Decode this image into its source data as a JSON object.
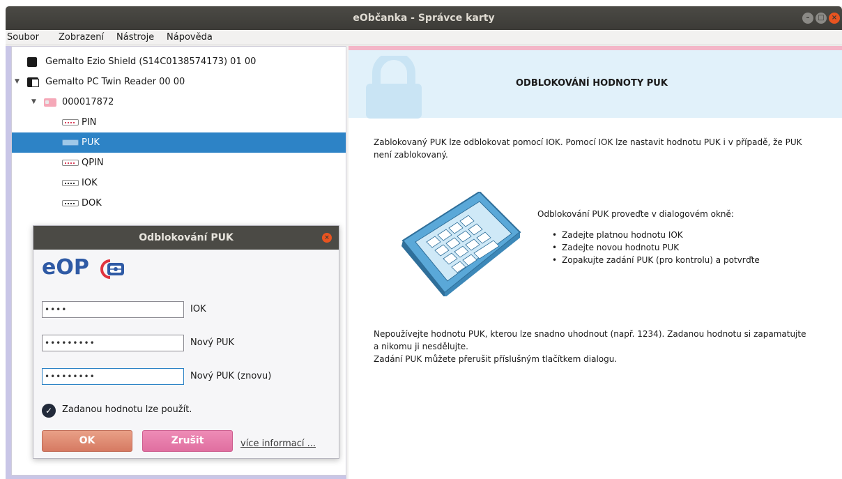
{
  "window": {
    "title": "eObčanka - Správce karty"
  },
  "menu": {
    "items": [
      "Soubor",
      "Zobrazení",
      "Nástroje",
      "Nápověda"
    ]
  },
  "tree": {
    "items": [
      {
        "label": "Gemalto Ezio Shield (S14C0138574173) 01 00",
        "icon": "card-reader-icon"
      },
      {
        "label": "Gemalto PC Twin Reader 00 00",
        "icon": "card-reader-icon"
      },
      {
        "label": "000017872",
        "icon": "id-card-icon"
      },
      {
        "label": "PIN",
        "icon": "key-icon"
      },
      {
        "label": "PUK",
        "icon": "key-icon",
        "selected": true
      },
      {
        "label": "QPIN",
        "icon": "key-icon"
      },
      {
        "label": "IOK",
        "icon": "key-icon"
      },
      {
        "label": "DOK",
        "icon": "key-icon"
      }
    ]
  },
  "dialog": {
    "title": "Odblokování PUK",
    "logo_text": "eOP",
    "fields": [
      {
        "label": "IOK",
        "value": "••••"
      },
      {
        "label": "Nový PUK",
        "value": "•••••••••"
      },
      {
        "label": "Nový PUK (znovu)",
        "value": "•••••••••"
      }
    ],
    "status": "Zadanou hodnotu lze použít.",
    "ok_label": "OK",
    "cancel_label": "Zrušit",
    "more_link": "více informací ..."
  },
  "info": {
    "title": "ODBLOKOVÁNÍ HODNOTY PUK",
    "para1_line1": "Zablokovaný PUK lze odblokovat pomocí IOK. Pomocí IOK lze nastavit hodnotu PUK i v případě, že PUK",
    "para1_line2": "není zablokovaný.",
    "steps_intro": "Odblokování PUK proveďte v dialogovém okně:",
    "steps": [
      "Zadejte platnou hodnotu IOK",
      "Zadejte novou hodnotu PUK",
      "Zopakujte zadání PUK (pro kontrolu) a potvrďte"
    ],
    "para2_line1": "Nepoužívejte hodnotu PUK, kterou lze snadno uhodnout (např. 1234). Zadanou hodnotu si zapamatujte",
    "para2_line2": "a nikomu ji nesdělujte.",
    "para3": "Zadání PUK můžete přerušit příslušným tlačítkem dialogu."
  },
  "colors": {
    "selection": "#2d83c6",
    "header_bg": "#e1f1fa",
    "ok_button": "#d67a62",
    "cancel_button": "#e06fa0",
    "logo_blue": "#2f5aa5",
    "logo_red": "#e0343f"
  }
}
